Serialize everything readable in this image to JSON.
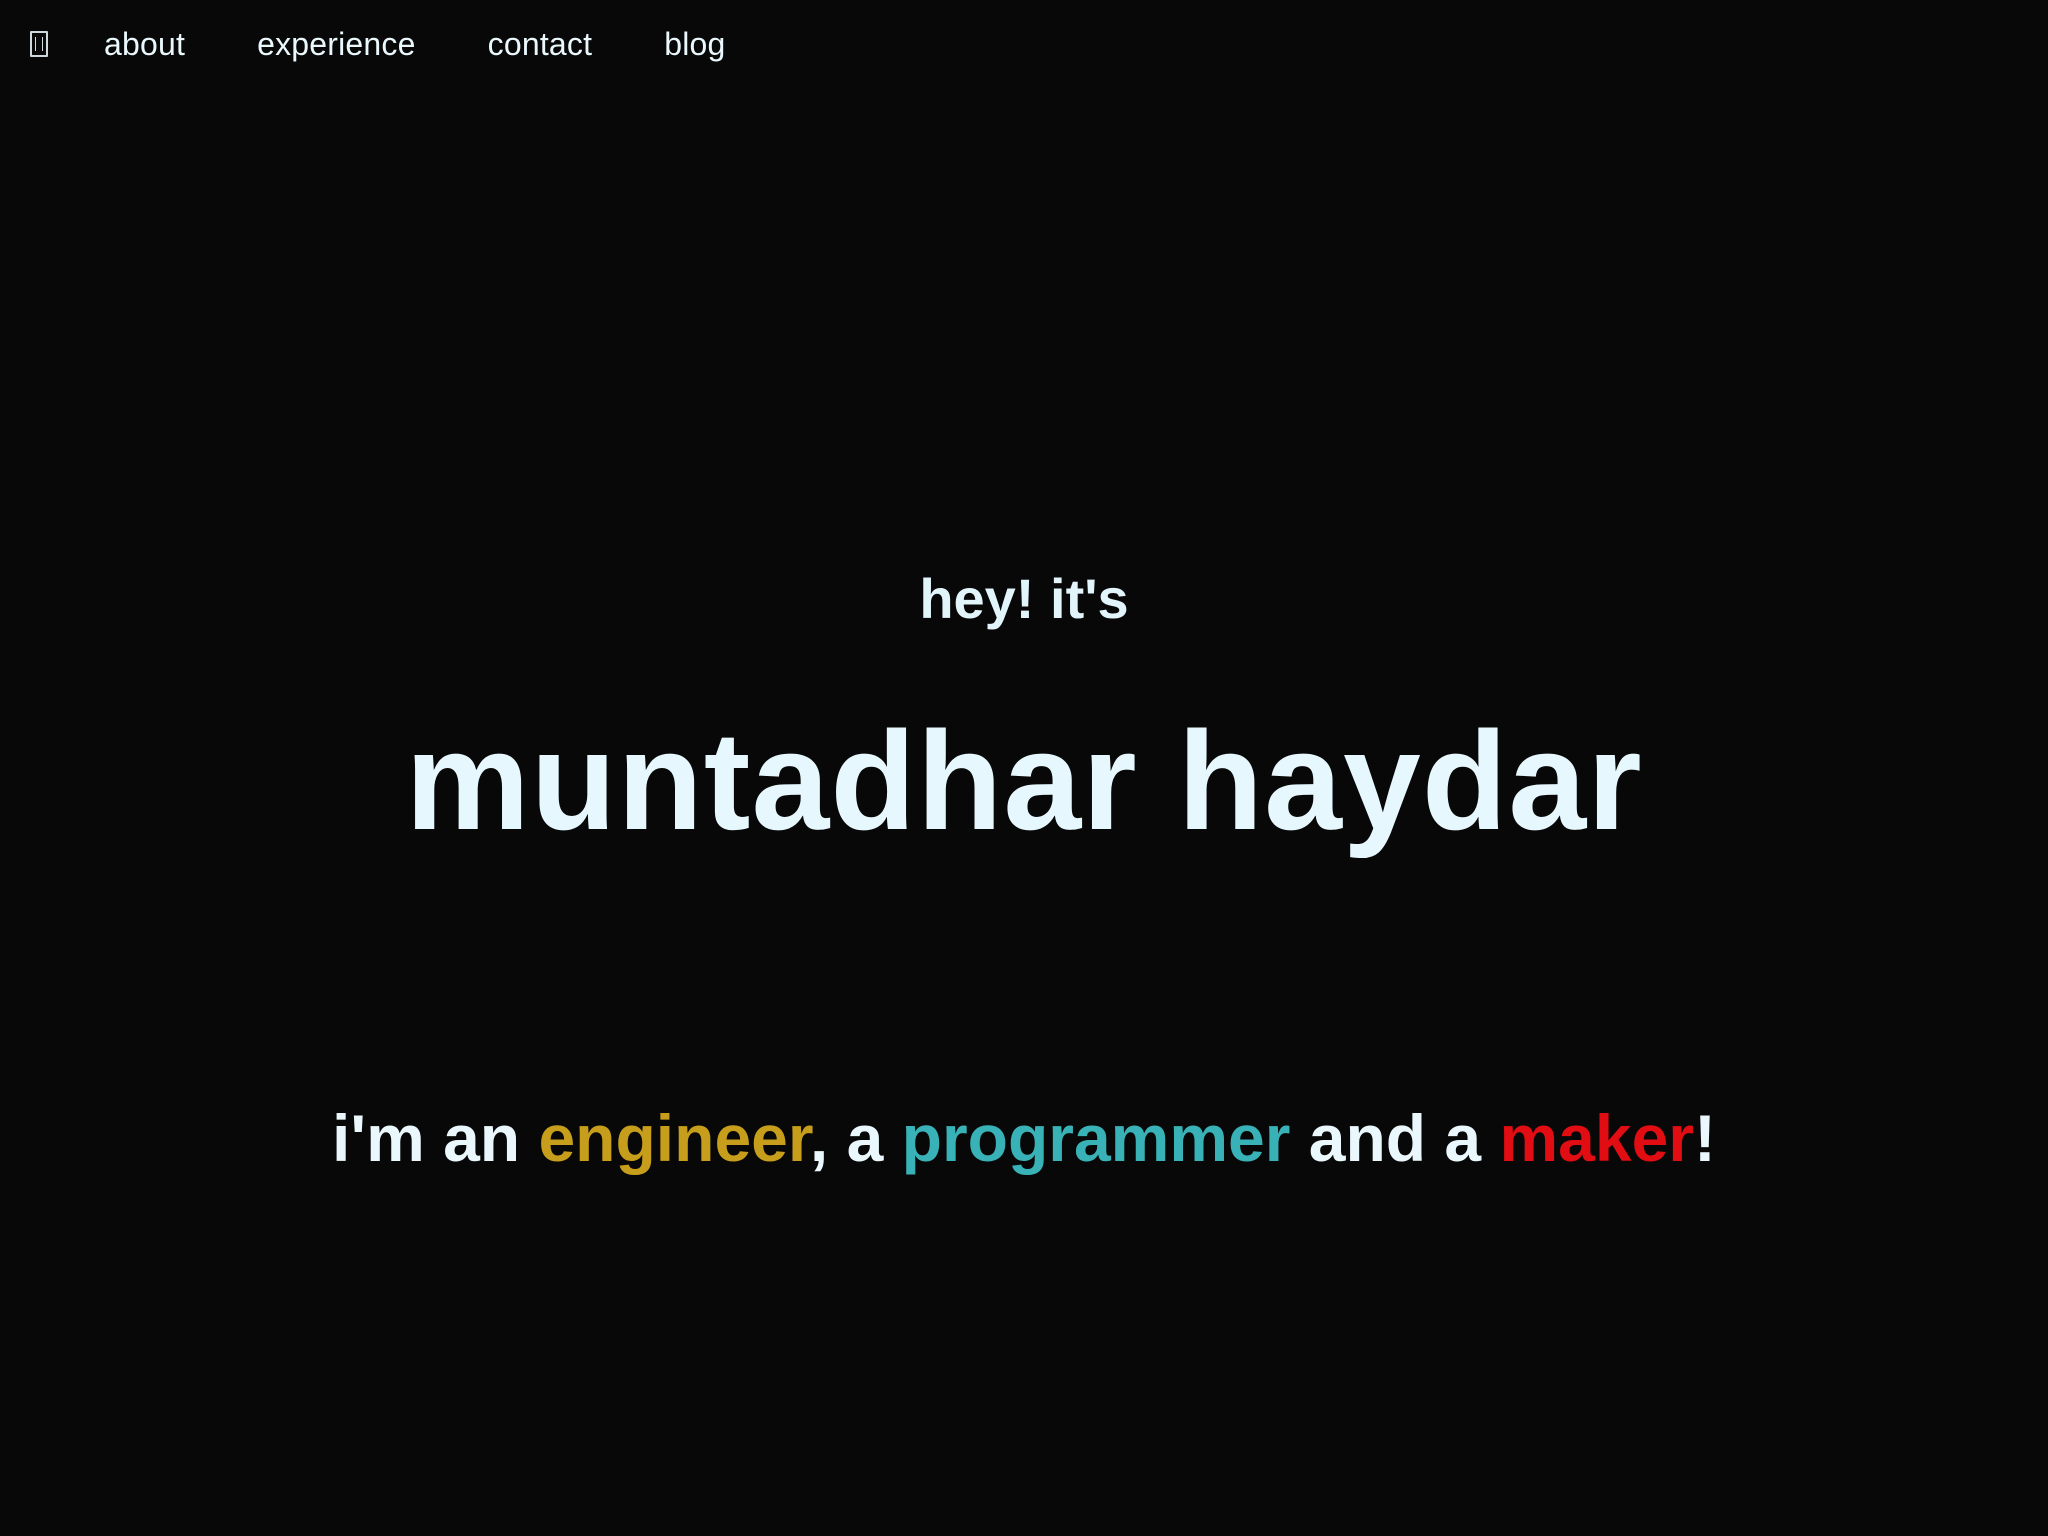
{
  "nav": {
    "home_icon": "home-icon",
    "items": [
      {
        "label": "about"
      },
      {
        "label": "experience"
      },
      {
        "label": "contact"
      },
      {
        "label": "blog"
      }
    ]
  },
  "hero": {
    "greeting": "hey! it's",
    "name": "muntadhar haydar",
    "tagline": {
      "prefix": "i'm an ",
      "keyword1": "engineer",
      "mid1": ", a ",
      "keyword2": "programmer",
      "mid2": " and a ",
      "keyword3": "maker",
      "suffix": "!"
    }
  },
  "colors": {
    "background": "#080808",
    "text": "#eaf8fd",
    "engineer": "#c79d1c",
    "programmer": "#39b2b7",
    "maker": "#e10d12"
  }
}
